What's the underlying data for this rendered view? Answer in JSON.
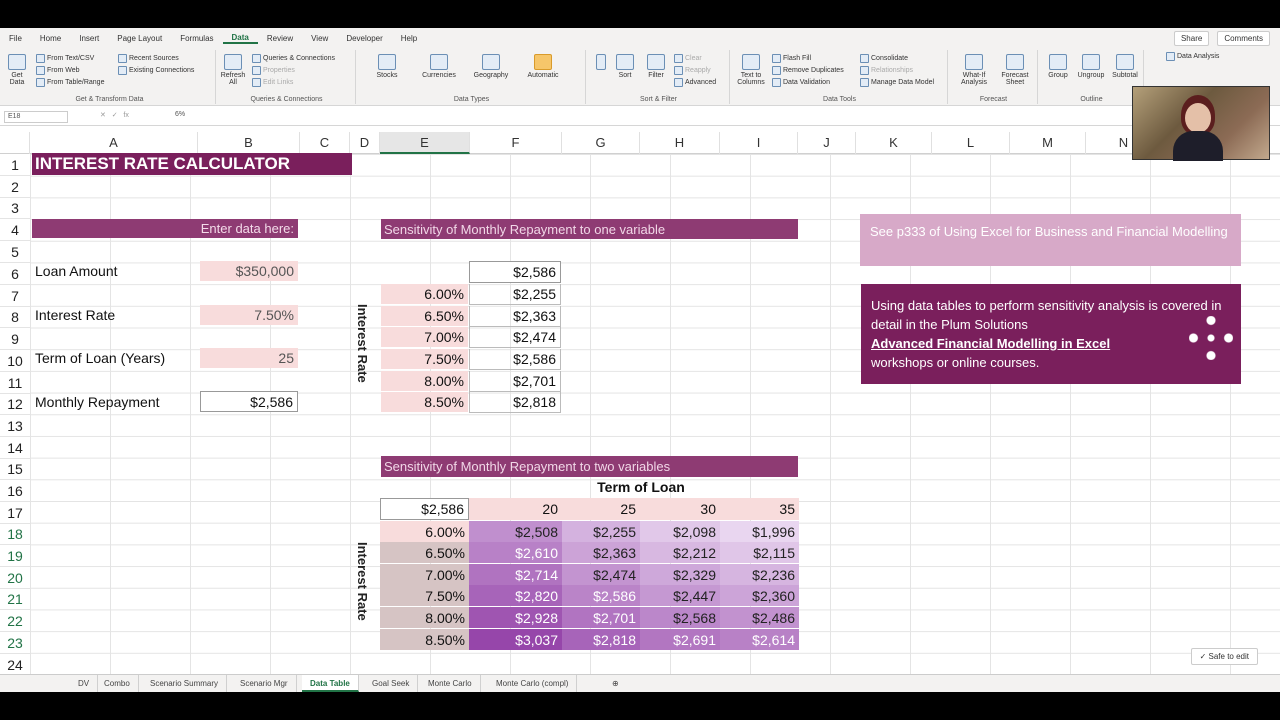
{
  "menu": [
    "File",
    "Home",
    "Insert",
    "Page Layout",
    "Formulas",
    "Data",
    "Review",
    "View",
    "Developer",
    "Help"
  ],
  "menu_right": {
    "share": "Share",
    "comments": "Comments"
  },
  "ribbon": {
    "get_data": "Get Data",
    "from_text": "From Text/CSV",
    "from_web": "From Web",
    "from_table": "From Table/Range",
    "recent_sources": "Recent Sources",
    "existing_connections": "Existing Connections",
    "group1": "Get & Transform Data",
    "refresh_all": "Refresh All",
    "queries": "Queries & Connections",
    "properties": "Properties",
    "edit_links": "Edit Links",
    "group2": "Queries & Connections",
    "stocks": "Stocks",
    "currencies": "Currencies",
    "geography": "Geography",
    "automatic": "Automatic",
    "group3": "Data Types",
    "sort": "Sort",
    "filter": "Filter",
    "clear": "Clear",
    "reapply": "Reapply",
    "advanced": "Advanced",
    "group4": "Sort & Filter",
    "text_to_columns": "Text to Columns",
    "flash_fill": "Flash Fill",
    "remove_duplicates": "Remove Duplicates",
    "data_validation": "Data Validation",
    "consolidate": "Consolidate",
    "relationships": "Relationships",
    "manage_data_model": "Manage Data Model",
    "group5": "Data Tools",
    "what_if": "What-If Analysis",
    "forecast_sheet": "Forecast Sheet",
    "group6": "Forecast",
    "group_btn": "Group",
    "ungroup": "Ungroup",
    "subtotal": "Subtotal",
    "group7": "Outline",
    "data_analysis": "Data Analysis"
  },
  "formula_bar": {
    "name_box": "E18",
    "value": "6%"
  },
  "columns": [
    "A",
    "B",
    "C",
    "D",
    "E",
    "F",
    "G",
    "H",
    "I",
    "J",
    "K",
    "L",
    "M",
    "N"
  ],
  "rows": [
    "1",
    "2",
    "3",
    "4",
    "5",
    "6",
    "7",
    "8",
    "9",
    "10",
    "11",
    "12",
    "13",
    "14",
    "15",
    "16",
    "17",
    "18",
    "19",
    "20",
    "21",
    "22",
    "23",
    "24"
  ],
  "calc": {
    "title": "INTEREST RATE CALCULATOR",
    "enter": "Enter data here:",
    "loan_label": "Loan Amount",
    "loan_value": "$350,000",
    "rate_label": "Interest Rate",
    "rate_value": "7.50%",
    "term_label": "Term of Loan (Years)",
    "term_value": "25",
    "repay_label": "Monthly Repayment",
    "repay_value": "$2,586"
  },
  "one_var": {
    "header": "Sensitivity of Monthly Repayment to one variable",
    "vert_label": "Interest Rate",
    "corner": "$2,586",
    "rates": [
      "6.00%",
      "6.50%",
      "7.00%",
      "7.50%",
      "8.00%",
      "8.50%"
    ],
    "values": [
      "$2,255",
      "$2,363",
      "$2,474",
      "$2,586",
      "$2,701",
      "$2,818"
    ]
  },
  "two_var": {
    "header": "Sensitivity of Monthly Repayment to two variables",
    "term_label": "Term of Loan",
    "vert_label": "Interest Rate",
    "corner": "$2,586",
    "terms": [
      "20",
      "25",
      "30",
      "35"
    ],
    "rates": [
      "6.00%",
      "6.50%",
      "7.00%",
      "7.50%",
      "8.00%",
      "8.50%"
    ],
    "table": [
      [
        "$2,508",
        "$2,255",
        "$2,098",
        "$1,996"
      ],
      [
        "$2,610",
        "$2,363",
        "$2,212",
        "$2,115"
      ],
      [
        "$2,714",
        "$2,474",
        "$2,329",
        "$2,236"
      ],
      [
        "$2,820",
        "$2,586",
        "$2,447",
        "$2,360"
      ],
      [
        "$2,928",
        "$2,701",
        "$2,568",
        "$2,486"
      ],
      [
        "$3,037",
        "$2,818",
        "$2,691",
        "$2,614"
      ]
    ]
  },
  "notes": {
    "note1": "See p333 of Using Excel for Business and Financial Modelling",
    "note2_a": "Using data tables to perform sensitivity analysis is covered in detail in the Plum Solutions",
    "note2_link": "Advanced Financial Modelling in Excel",
    "note2_b": "workshops or online courses."
  },
  "tabs": [
    "DV",
    "Combo",
    "Scenario Summary",
    "Scenario Mgr",
    "Data Table",
    "Goal Seek",
    "Monte Carlo",
    "Monte Carlo (compl)"
  ],
  "active_tab": "Data Table",
  "safe_to_edit": "Safe to edit",
  "colors": {
    "title": "#7a1f5c",
    "header": "#8e3b73",
    "pink": "#f8dcdc",
    "accent": "#217346"
  }
}
